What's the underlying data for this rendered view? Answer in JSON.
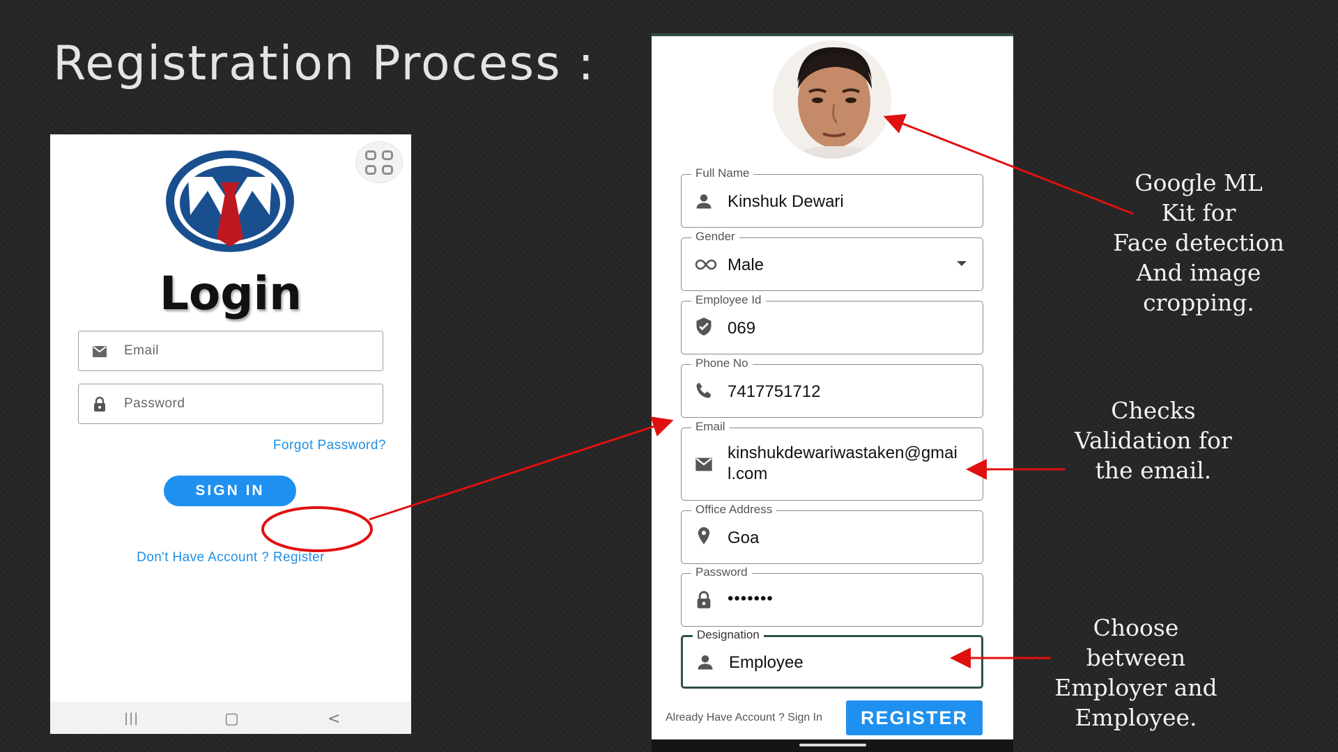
{
  "slide": {
    "title": "Registration Process :"
  },
  "login": {
    "title": "Login",
    "email_placeholder": "Email",
    "password_placeholder": "Password",
    "forgot_password": "Forgot Password?",
    "sign_in": "SIGN IN",
    "register_link": "Don't Have Account ? Register",
    "nav": {
      "recents": "|||",
      "home": "▢",
      "back": "<"
    }
  },
  "register": {
    "fields": [
      {
        "label": "Full Name",
        "value": "Kinshuk Dewari",
        "icon": "person-icon"
      },
      {
        "label": "Gender",
        "value": "Male",
        "icon": "infinity-icon"
      },
      {
        "label": "Employee Id",
        "value": "069",
        "icon": "shield-check-icon"
      },
      {
        "label": "Phone No",
        "value": "7417751712",
        "icon": "phone-icon"
      },
      {
        "label": "Email",
        "value_line1": "kinshukdewariwastaken@gmai",
        "value_line2": "l.com",
        "icon": "mail-icon"
      },
      {
        "label": "Office Address",
        "value": "Goa",
        "icon": "location-pin-icon"
      },
      {
        "label": "Password",
        "value": "•••••••",
        "icon": "lock-icon"
      },
      {
        "label": "Designation",
        "value": "Employee",
        "icon": "person-icon"
      }
    ],
    "already_have_account": "Already Have Account ? Sign In",
    "register_button": "REGISTER"
  },
  "annotations": {
    "face": [
      "Google ML",
      "Kit for",
      "Face detection",
      "And image",
      "cropping."
    ],
    "email": [
      "Checks",
      "Validation for",
      "the email."
    ],
    "designation": [
      "Choose",
      "between",
      "Employer and",
      "Employee."
    ]
  },
  "colors": {
    "accent_blue": "#1e90f0",
    "arrow_red": "#e01010",
    "active_border": "#2f4f44"
  }
}
